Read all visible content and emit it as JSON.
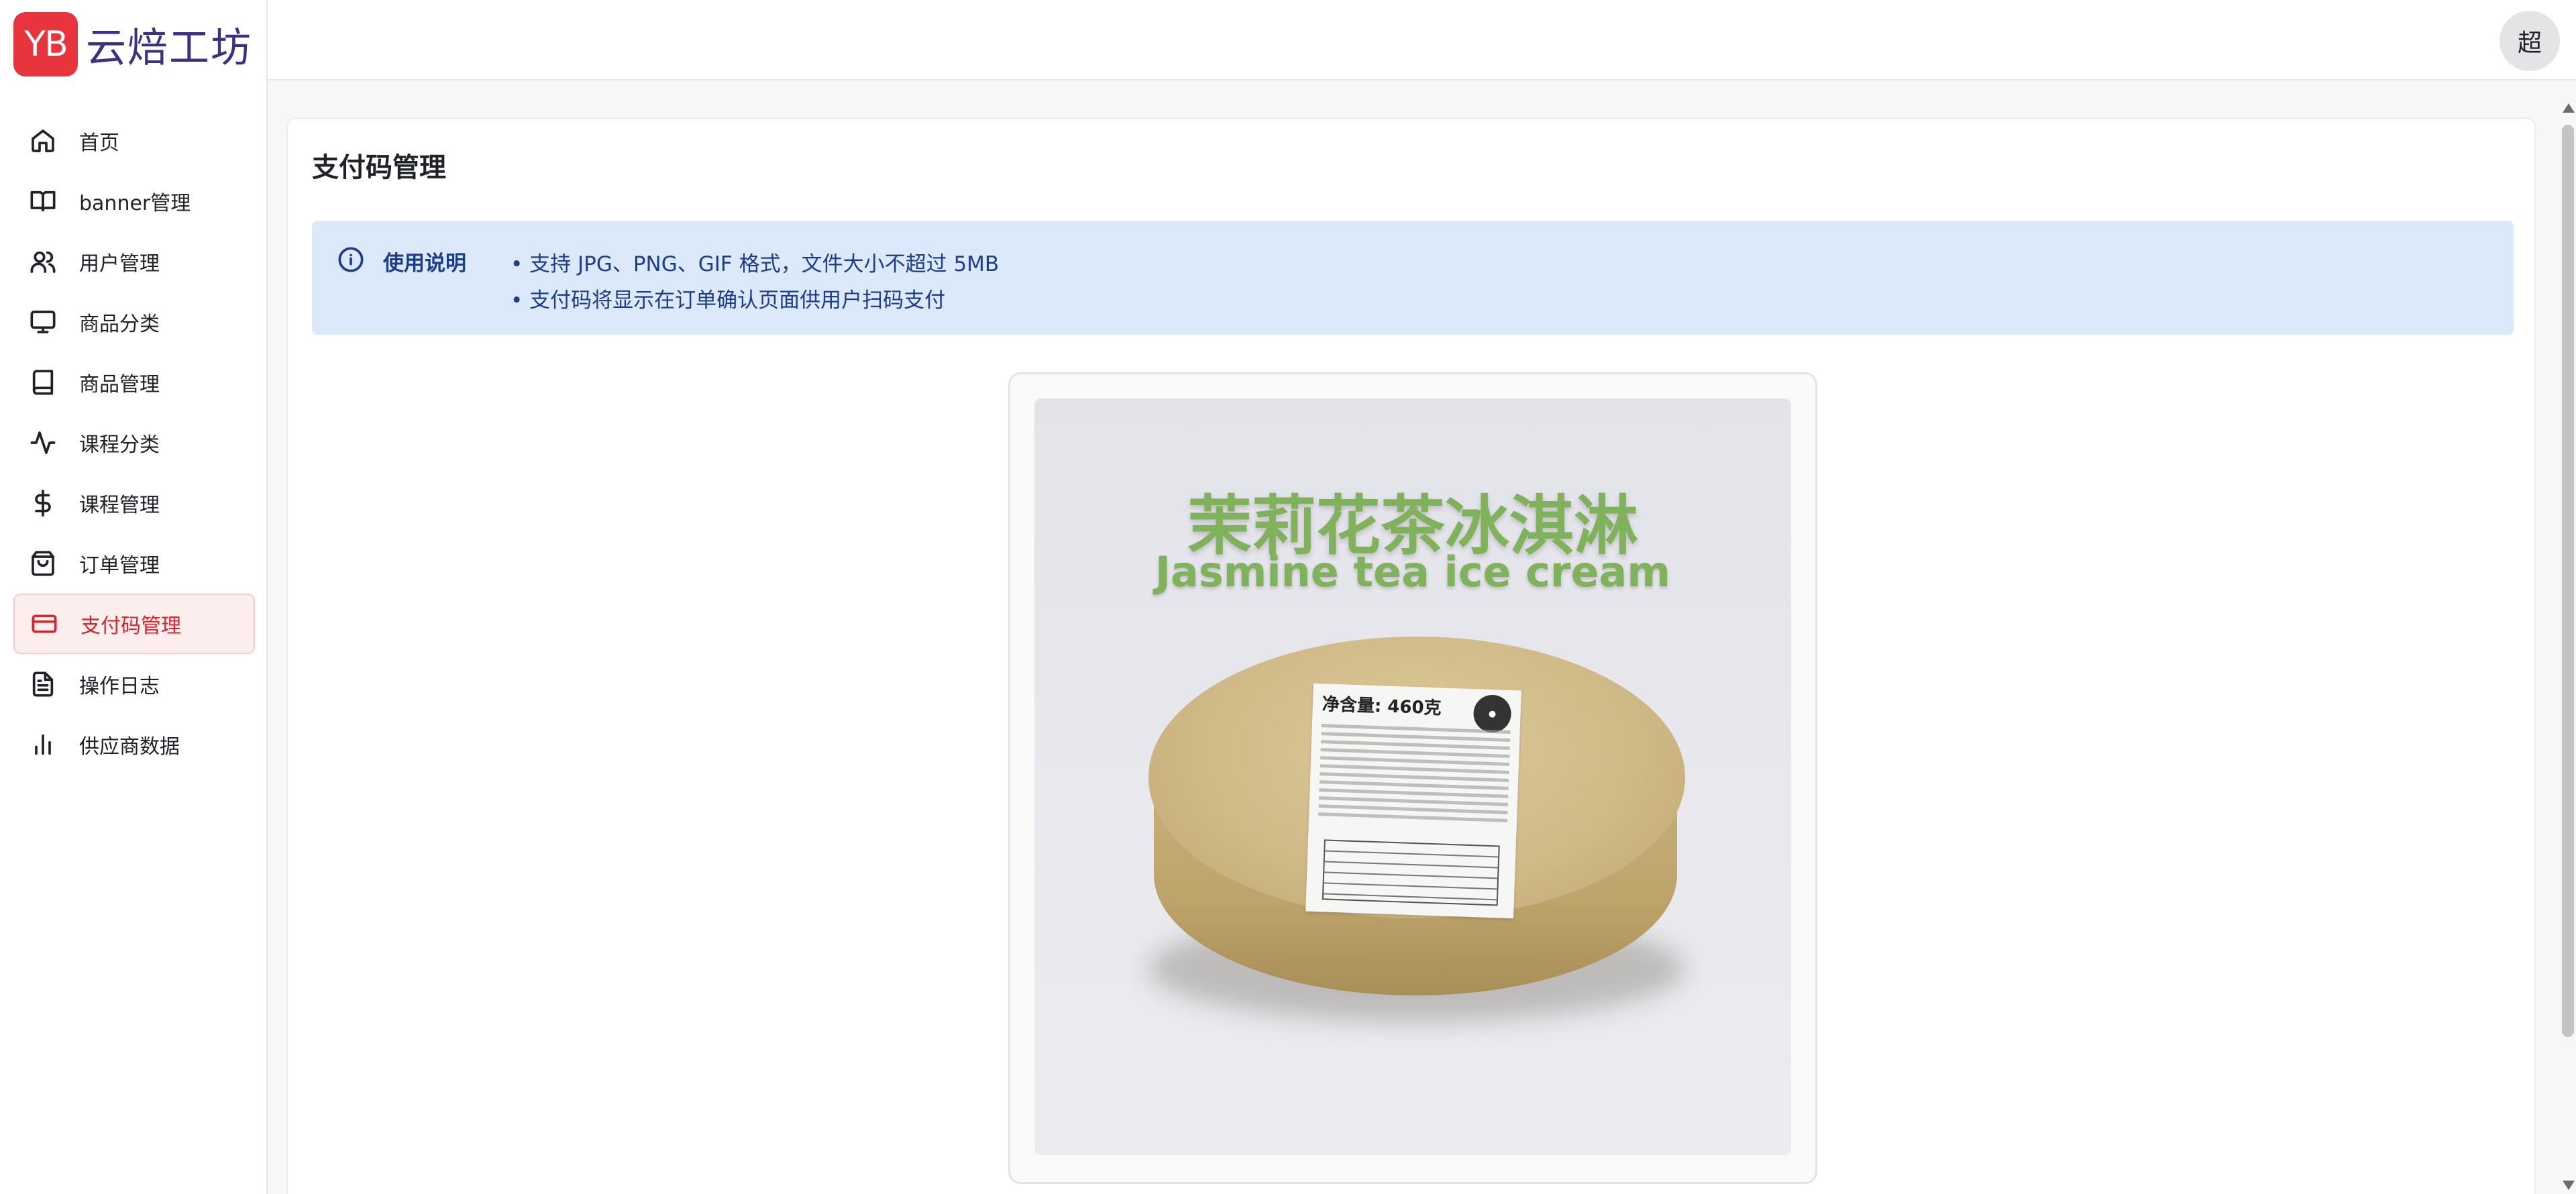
{
  "app": {
    "logo_badge": "YB",
    "name": "云焙工坊"
  },
  "user": {
    "avatar_text": "超"
  },
  "sidebar": {
    "items": [
      {
        "label": "首页",
        "icon": "home-icon"
      },
      {
        "label": "banner管理",
        "icon": "book-open-icon"
      },
      {
        "label": "用户管理",
        "icon": "users-icon"
      },
      {
        "label": "商品分类",
        "icon": "monitor-icon"
      },
      {
        "label": "商品管理",
        "icon": "book-icon"
      },
      {
        "label": "课程分类",
        "icon": "activity-icon"
      },
      {
        "label": "课程管理",
        "icon": "dollar-icon"
      },
      {
        "label": "订单管理",
        "icon": "shopping-bag-icon"
      },
      {
        "label": "支付码管理",
        "icon": "credit-card-icon",
        "active": true
      },
      {
        "label": "操作日志",
        "icon": "file-text-icon"
      },
      {
        "label": "供应商数据",
        "icon": "bar-chart-icon"
      }
    ]
  },
  "page": {
    "title": "支付码管理",
    "notice": {
      "title": "使用说明",
      "lines": [
        "• 支持 JPG、PNG、GIF 格式，文件大小不超过 5MB",
        "• 支付码将显示在订单确认页面供用户扫码支付"
      ]
    },
    "preview": {
      "title_cn": "茉莉花茶冰淇淋",
      "title_en": "Jasmine tea ice cream",
      "label_net_weight": "净含量: 460克"
    }
  },
  "colors": {
    "accent": "#d8262e",
    "logo_bg": "#e8343c",
    "notice_bg": "#dce9fb",
    "notice_text": "#1c3d8c",
    "product_title": "#7fb25a"
  }
}
